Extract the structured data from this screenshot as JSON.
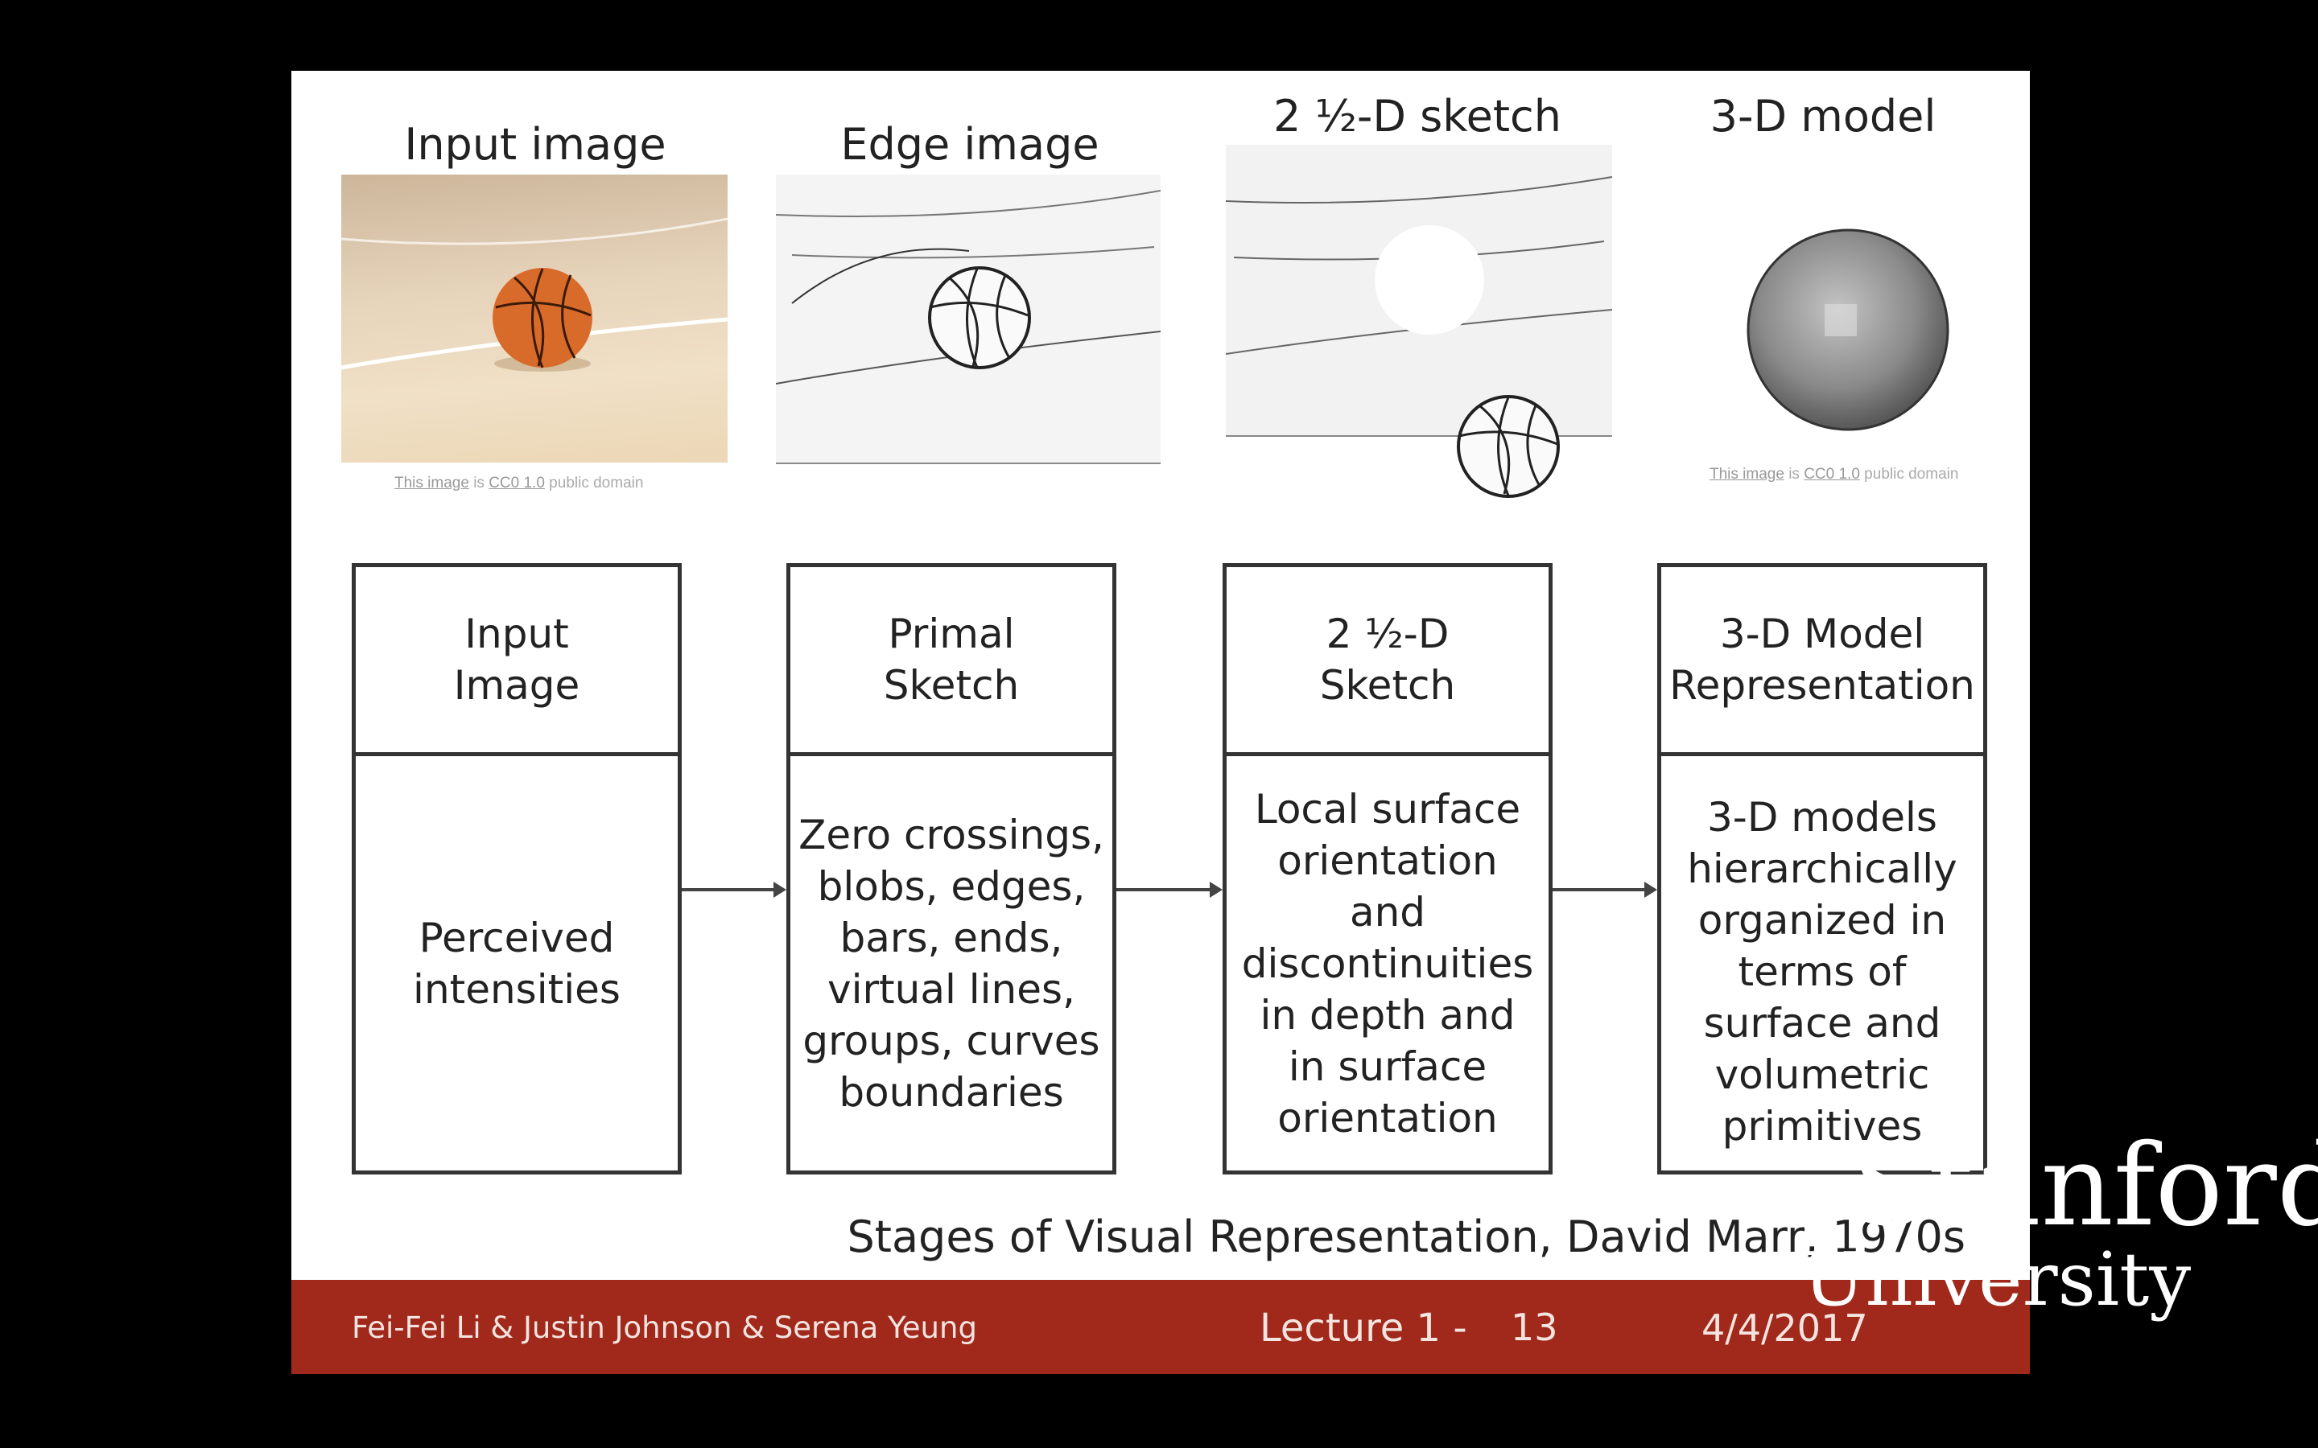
{
  "slide": {
    "image_titles": [
      "Input image",
      "Edge image",
      "2 ½-D sketch",
      "3-D model"
    ],
    "credit": {
      "link1": "This image",
      "mid": " is ",
      "link2": "CC0 1.0",
      "tail": " public domain"
    },
    "stages": [
      {
        "head": "Input\nImage",
        "body": "Perceived\nintensities"
      },
      {
        "head": "Primal\nSketch",
        "body": "Zero crossings,\nblobs, edges,\nbars, ends,\nvirtual lines,\ngroups, curves\nboundaries"
      },
      {
        "head": "2 ½-D\nSketch",
        "body": "Local surface\norientation\nand\ndiscontinuities\nin depth and\nin surface\norientation"
      },
      {
        "head": "3-D Model\nRepresentation",
        "body": "3-D models\nhierarchically\norganized in\nterms of\nsurface and\nvolumetric\nprimitives"
      }
    ],
    "caption": "Stages of Visual Representation, David Marr, 1970s"
  },
  "footer": {
    "authors": "Fei-Fei Li & Justin Johnson & Serena Yeung",
    "lecture": "Lecture 1 -",
    "page": "13",
    "date": "4/4/2017",
    "color": "#a0291b"
  },
  "watermark": {
    "line1": "Stanford",
    "line2": "University"
  }
}
